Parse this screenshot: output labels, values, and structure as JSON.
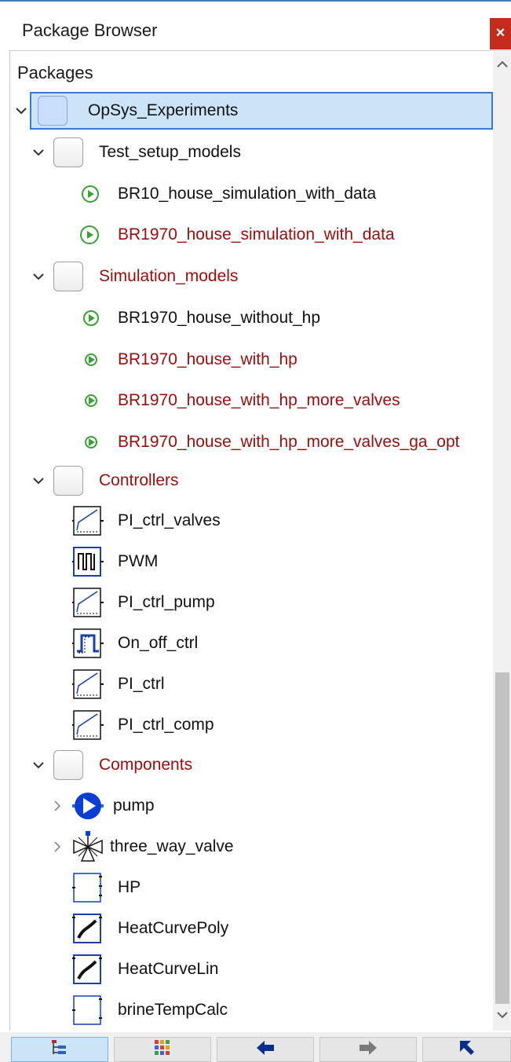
{
  "window": {
    "title": "Package Browser",
    "close_label": "×"
  },
  "tree": {
    "header": "Packages",
    "root": {
      "label": "OpSys_Experiments"
    },
    "groups": [
      {
        "label": "Test_setup_models",
        "color": "black",
        "items": [
          {
            "label": "BR10_house_simulation_with_data",
            "color": "black"
          },
          {
            "label": "BR1970_house_simulation_with_data",
            "color": "red"
          }
        ]
      },
      {
        "label": "Simulation_models",
        "color": "red",
        "items": [
          {
            "label": "BR1970_house_without_hp",
            "color": "black"
          },
          {
            "label": "BR1970_house_with_hp",
            "color": "red"
          },
          {
            "label": "BR1970_house_with_hp_more_valves",
            "color": "red"
          },
          {
            "label": "BR1970_house_with_hp_more_valves_ga_opt",
            "color": "red"
          }
        ]
      },
      {
        "label": "Controllers",
        "color": "red",
        "items": [
          {
            "label": "PI_ctrl_valves",
            "icon": "pi-icon"
          },
          {
            "label": "PWM",
            "icon": "pwm-icon"
          },
          {
            "label": "PI_ctrl_pump",
            "icon": "pi-icon"
          },
          {
            "label": "On_off_ctrl",
            "icon": "onoff-icon"
          },
          {
            "label": "PI_ctrl",
            "icon": "pi-icon"
          },
          {
            "label": "PI_ctrl_comp",
            "icon": "pi-icon"
          }
        ]
      },
      {
        "label": "Components",
        "color": "red",
        "items": [
          {
            "label": "pump",
            "icon": "pump-icon"
          },
          {
            "label": "three_way_valve",
            "icon": "valve-icon"
          },
          {
            "label": "HP",
            "icon": "block-icon"
          },
          {
            "label": "HeatCurvePoly",
            "icon": "heatcurve-icon"
          },
          {
            "label": "HeatCurveLin",
            "icon": "heatcurve-icon"
          },
          {
            "label": "brineTempCalc",
            "icon": "block-icon"
          }
        ]
      }
    ]
  },
  "colors": {
    "red_text": "#9b0d0d",
    "selection": "#cce4f7",
    "selection_border": "#3d7ad7",
    "play_green": "#3aa137"
  }
}
